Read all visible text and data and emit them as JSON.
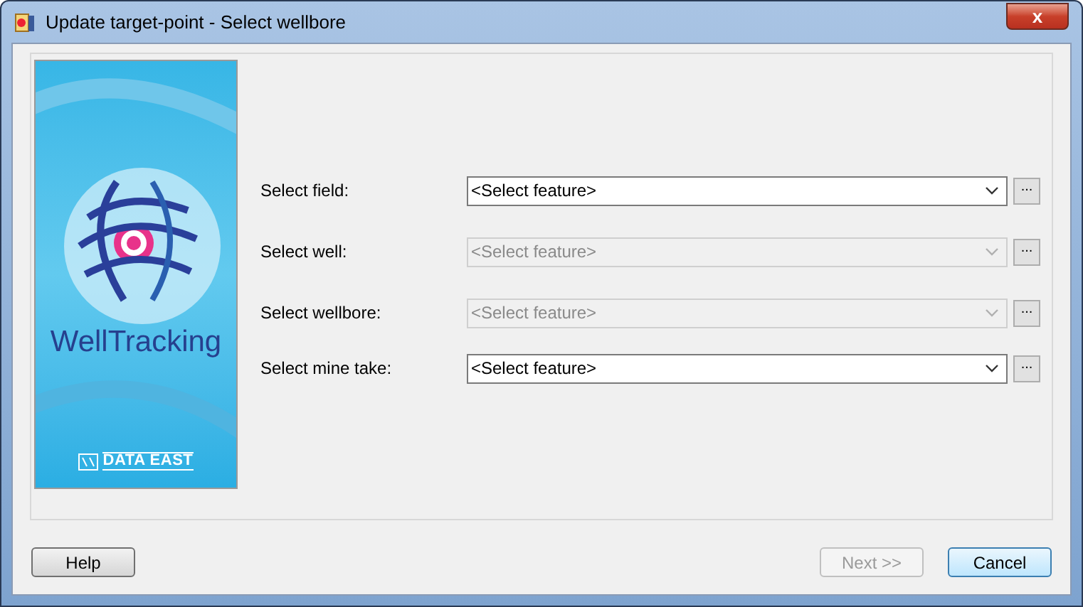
{
  "window": {
    "title": "Update target-point - Select wellbore",
    "close": "x"
  },
  "banner": {
    "product": "WellTracking",
    "company": "DATA EAST"
  },
  "rows": [
    {
      "label": "Select field:",
      "value": "<Select feature>",
      "disabled": false,
      "browse": "..."
    },
    {
      "label": "Select well:",
      "value": "<Select feature>",
      "disabled": true,
      "browse": "..."
    },
    {
      "label": "Select wellbore:",
      "value": "<Select feature>",
      "disabled": true,
      "browse": "..."
    },
    {
      "label": "Select mine take:",
      "value": "<Select feature>",
      "disabled": false,
      "browse": "..."
    }
  ],
  "buttons": [
    {
      "label": "Help",
      "disabled": false,
      "default": false
    },
    {
      "label": "Next >>",
      "disabled": true,
      "default": false
    },
    {
      "label": "Cancel",
      "disabled": false,
      "default": true
    }
  ]
}
